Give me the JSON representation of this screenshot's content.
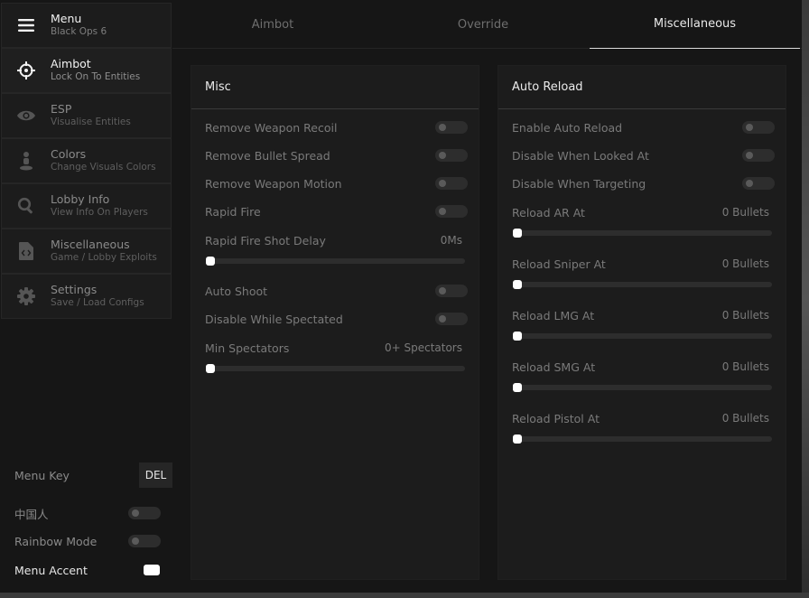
{
  "sidebar": {
    "header": {
      "title": "Menu",
      "subtitle": "Black Ops 6",
      "icon": "hamburger-icon"
    },
    "items": [
      {
        "title": "Aimbot",
        "subtitle": "Lock On To Entities",
        "icon": "crosshair-icon",
        "active": true
      },
      {
        "title": "ESP",
        "subtitle": "Visualise Entities",
        "icon": "eye-icon",
        "active": false
      },
      {
        "title": "Colors",
        "subtitle": "Change Visuals Colors",
        "icon": "person-marker-icon",
        "active": false
      },
      {
        "title": "Lobby Info",
        "subtitle": "View Info On Players",
        "icon": "search-icon",
        "active": false
      },
      {
        "title": "Miscellaneous",
        "subtitle": "Game / Lobby Exploits",
        "icon": "code-file-icon",
        "active": false
      },
      {
        "title": "Settings",
        "subtitle": "Save / Load Configs",
        "icon": "gear-icon",
        "active": false
      }
    ],
    "menu_key_label": "Menu Key",
    "menu_key_value": "DEL",
    "chinese_label": "中国人",
    "rainbow_label": "Rainbow Mode",
    "accent_label": "Menu Accent",
    "accent_color": "#ffffff"
  },
  "tabs": [
    {
      "label": "Aimbot",
      "active": false
    },
    {
      "label": "Override",
      "active": false
    },
    {
      "label": "Miscellaneous",
      "active": true
    }
  ],
  "misc_panel": {
    "title": "Misc",
    "remove_recoil": "Remove Weapon Recoil",
    "remove_spread": "Remove Bullet Spread",
    "remove_motion": "Remove Weapon Motion",
    "rapid_fire": "Rapid Fire",
    "rapid_fire_delay": {
      "label": "Rapid Fire Shot Delay",
      "value": "0Ms",
      "fraction": 0
    },
    "auto_shoot": "Auto Shoot",
    "disable_spectated": "Disable While Spectated",
    "min_spectators": {
      "label": "Min Spectators",
      "value": "0+ Spectators",
      "fraction": 0
    }
  },
  "reload_panel": {
    "title": "Auto Reload",
    "enable": "Enable Auto Reload",
    "disable_looked": "Disable When Looked At",
    "disable_targeting": "Disable When Targeting",
    "ar": {
      "label": "Reload AR At",
      "value": "0 Bullets",
      "fraction": 0
    },
    "sniper": {
      "label": "Reload Sniper At",
      "value": "0 Bullets",
      "fraction": 0
    },
    "lmg": {
      "label": "Reload LMG At",
      "value": "0 Bullets",
      "fraction": 0
    },
    "smg": {
      "label": "Reload SMG At",
      "value": "0 Bullets",
      "fraction": 0
    },
    "pistol": {
      "label": "Reload Pistol At",
      "value": "0 Bullets",
      "fraction": 0
    }
  },
  "colors": {
    "background": "#161616",
    "panel": "#1c1c1c",
    "accent": "#ffffff",
    "toggle_off": "#2d2d2d"
  }
}
